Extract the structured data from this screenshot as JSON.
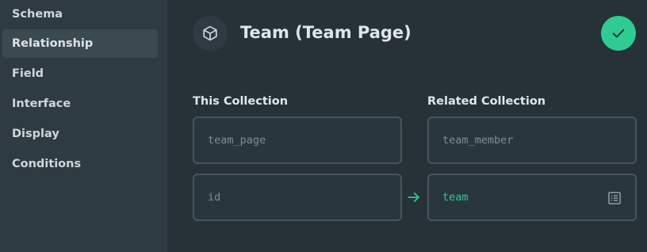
{
  "sidebar": {
    "items": [
      {
        "label": "Schema",
        "active": false
      },
      {
        "label": "Relationship",
        "active": true
      },
      {
        "label": "Field",
        "active": false
      },
      {
        "label": "Interface",
        "active": false
      },
      {
        "label": "Display",
        "active": false
      },
      {
        "label": "Conditions",
        "active": false
      }
    ]
  },
  "header": {
    "icon": "cube-icon",
    "title": "Team (Team Page)",
    "save_icon": "check-icon"
  },
  "relationship": {
    "this_collection": {
      "label": "This Collection",
      "collection_placeholder": "team_page",
      "field_placeholder": "id"
    },
    "related_collection": {
      "label": "Related Collection",
      "collection_placeholder": "team_member",
      "field_value": "team"
    },
    "arrow_icon": "arrow-right-icon",
    "list_icon": "list-alt-icon"
  },
  "colors": {
    "background": "#263238",
    "sidebar": "#2f3b42",
    "accent": "#2ecc92"
  }
}
